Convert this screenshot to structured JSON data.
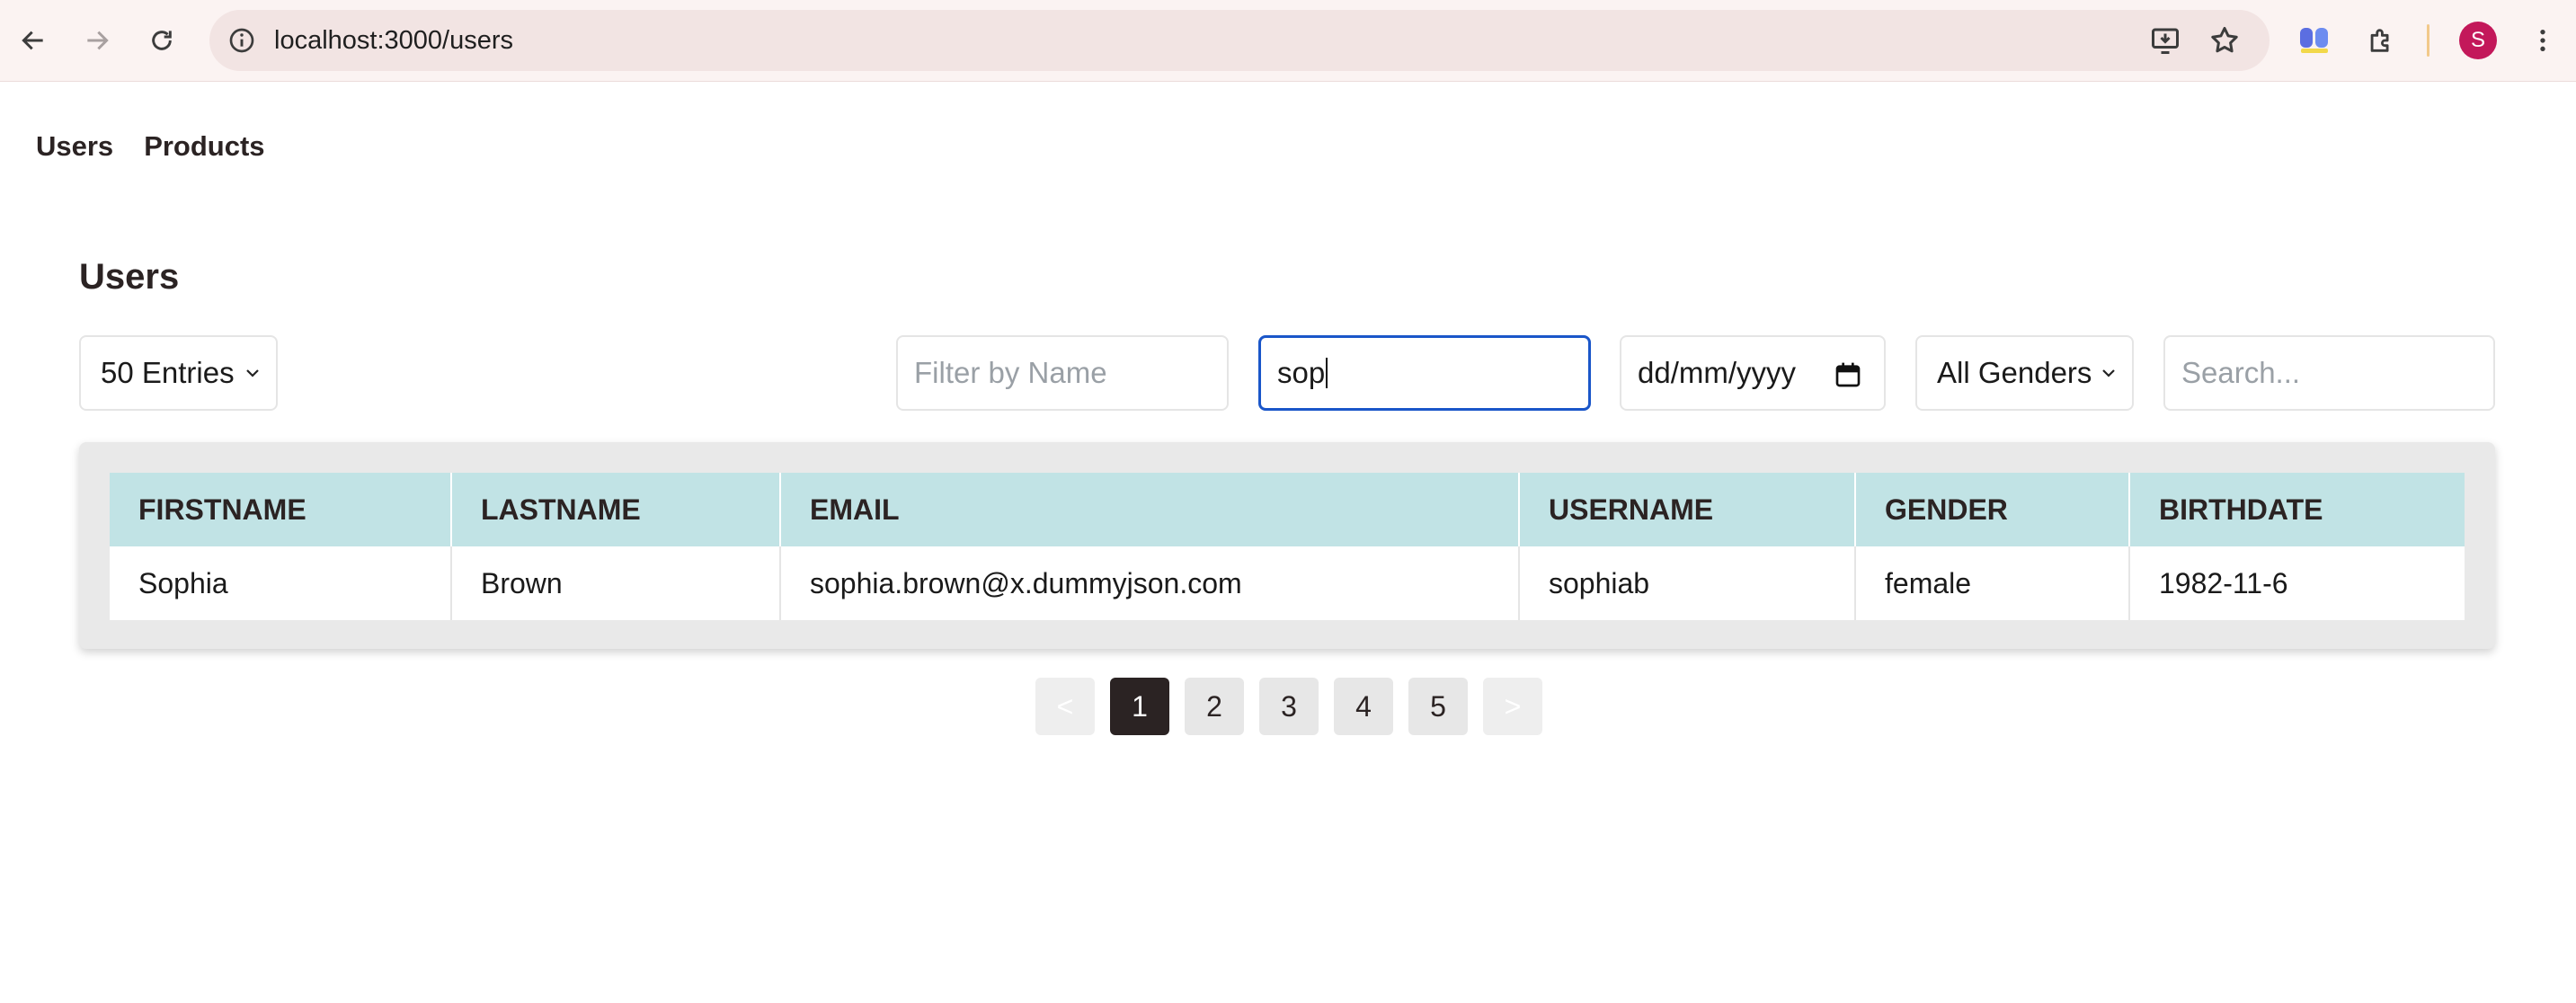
{
  "browser": {
    "url": "localhost:3000/users",
    "profile_initial": "S",
    "icons": [
      "back-icon",
      "forward-icon",
      "reload-icon",
      "site-info-icon",
      "install-app-icon",
      "bookmark-star-icon",
      "extension-colorful-icon",
      "extensions-puzzle-icon",
      "more-menu-icon"
    ]
  },
  "nav": {
    "items": [
      "Users",
      "Products"
    ]
  },
  "page": {
    "title": "Users"
  },
  "controls": {
    "entries_value": "50 Entries",
    "filter_name_placeholder": "Filter by Name",
    "filter_username_value": "sop",
    "date_placeholder": "dd/mm/yyyy",
    "gender_value": "All Genders",
    "search_placeholder": "Search..."
  },
  "table": {
    "headers": [
      "FIRSTNAME",
      "LASTNAME",
      "EMAIL",
      "USERNAME",
      "GENDER",
      "BIRTHDATE"
    ],
    "rows": [
      [
        "Sophia",
        "Brown",
        "sophia.brown@x.dummyjson.com",
        "sophiab",
        "female",
        "1982-11-6"
      ]
    ]
  },
  "pagination": {
    "prev": "<",
    "next": ">",
    "pages": [
      "1",
      "2",
      "3",
      "4",
      "5"
    ],
    "current": "1"
  },
  "colors": {
    "header_bg": "#c1e3e5",
    "active_page": "#2b2323",
    "focus_border": "#1a56c9",
    "avatar": "#c3185a"
  }
}
